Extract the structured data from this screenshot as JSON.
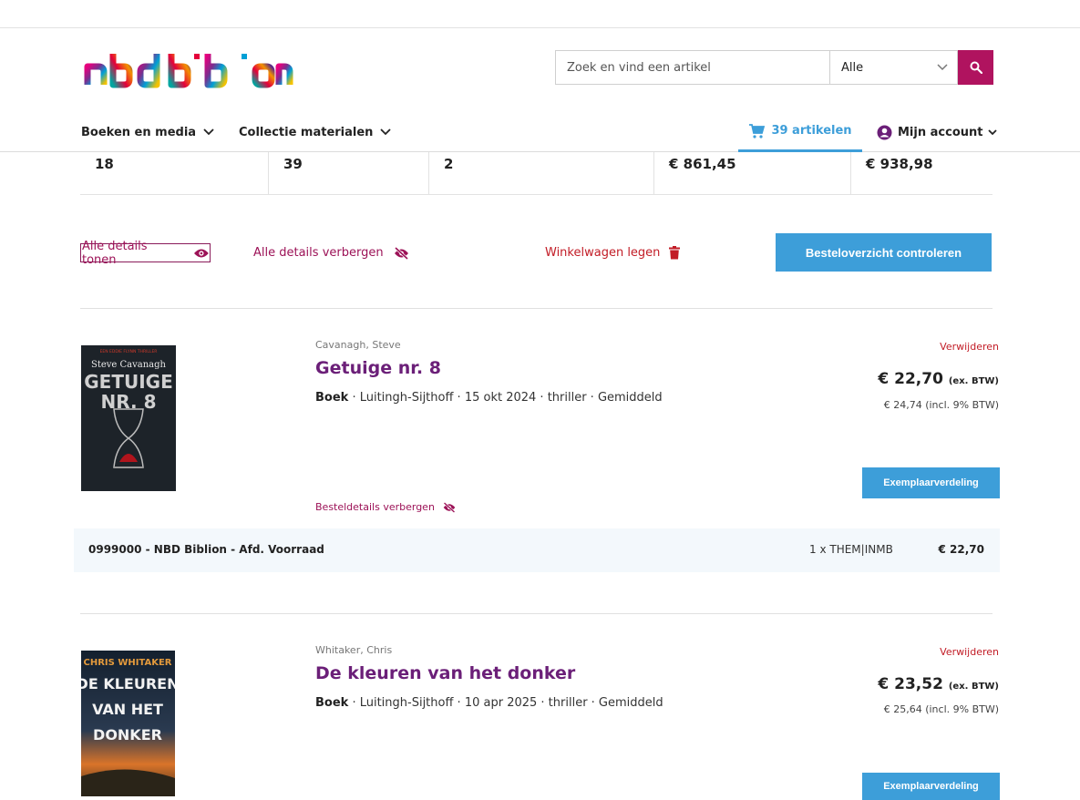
{
  "brand": {
    "name": "nbd biblion"
  },
  "search": {
    "placeholder": "Zoek en vind een artikel",
    "category": "Alle"
  },
  "nav": {
    "books": "Boeken en media",
    "materials": "Collectie materialen",
    "cart": "39 artikelen",
    "account": "Mijn account"
  },
  "summary": [
    "18",
    "39",
    "2",
    "€ 861,45",
    "€ 938,98"
  ],
  "actions": {
    "show_all": "Alle details tonen",
    "hide_all": "Alle details verbergen",
    "clear_cart": "Winkelwagen legen",
    "review": "Besteloverzicht controleren"
  },
  "items": [
    {
      "author": "Cavanagh, Steve",
      "title": "Getuige nr. 8",
      "type": "Boek",
      "meta": " · Luitingh-Sijthoff · 15 okt 2024 · thriller · Gemiddeld",
      "remove": "Verwijderen",
      "price_ex": "€ 22,70",
      "price_ex_label": "(ex. BTW)",
      "price_incl": "€ 24,74 (incl. 9% BTW)",
      "split_button": "Exemplaarverdeling",
      "toggle_details": "Besteldetails verbergen",
      "cover": {
        "tagline": "EEN EDDIE FLYNN THRILLER",
        "author": "Steve Cavanagh",
        "title1": "GETUIGE",
        "title2": "NR. 8",
        "bg": "#1d2329"
      },
      "order_line": {
        "branch": "0999000 - NBD Biblion - Afd. Voorraad",
        "qty": "1 x  THEM|INMB",
        "price": "€ 22,70"
      }
    },
    {
      "author": "Whitaker, Chris",
      "title": "De kleuren van het donker",
      "type": "Boek",
      "meta": " · Luitingh-Sijthoff · 10 apr 2025 · thriller · Gemiddeld",
      "remove": "Verwijderen",
      "price_ex": "€ 23,52",
      "price_ex_label": "(ex. BTW)",
      "price_incl": "€ 25,64 (incl. 9% BTW)",
      "split_button": "Exemplaarverdeling",
      "cover": {
        "author": "CHRIS WHITAKER",
        "title1": "DE KLEUREN",
        "title2": "VAN HET",
        "title3": "DONKER",
        "bg": "#1c2a3a"
      }
    }
  ],
  "colors": {
    "accent": "#b0135f",
    "blue": "#3d9ed9",
    "title": "#6b1f78",
    "danger": "#c21c26"
  }
}
